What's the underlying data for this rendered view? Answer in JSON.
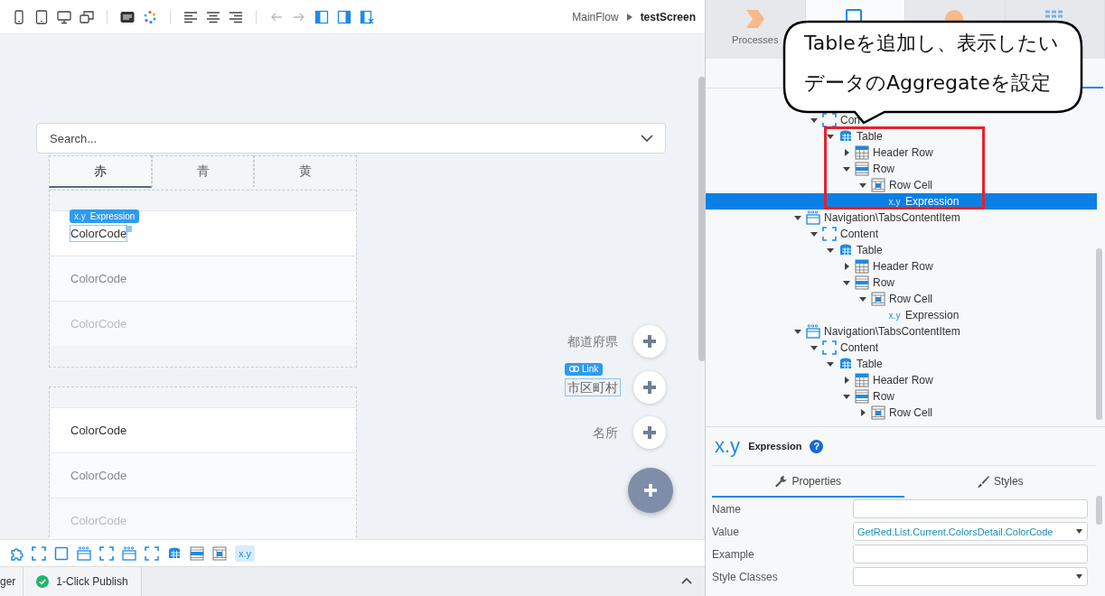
{
  "toolbar": {
    "breadcrumb": [
      {
        "label": "MainFlow",
        "current": false
      },
      {
        "label": "testScreen",
        "current": true
      }
    ]
  },
  "canvas": {
    "search": {
      "placeholder": "Search..."
    },
    "tabs": [
      {
        "label": "赤",
        "selected": true
      },
      {
        "label": "青",
        "selected": false
      },
      {
        "label": "黄",
        "selected": false
      }
    ],
    "tables": [
      {
        "rows": [
          {
            "text": "ColorCode",
            "selected": true,
            "badge": "Expression",
            "badge_glyph": "x.y"
          },
          {
            "text": "ColorCode",
            "selected": false
          },
          {
            "text": "ColorCode",
            "selected": false
          }
        ]
      },
      {
        "rows": [
          {
            "text": "ColorCode",
            "selected": false
          },
          {
            "text": "ColorCode",
            "selected": false
          },
          {
            "text": "ColorCode",
            "selected": false
          }
        ]
      }
    ],
    "actions": [
      {
        "label": "都道府県",
        "selected": false
      },
      {
        "label": "市区町村",
        "selected": true,
        "badge": "Link"
      },
      {
        "label": "名所",
        "selected": false
      }
    ]
  },
  "widget_bar": {
    "current": {
      "label": "x.y",
      "selected": true
    }
  },
  "bottom_tabs": [
    {
      "label": "ger",
      "kind": "plain"
    },
    {
      "label": "1-Click Publish",
      "kind": "status"
    }
  ],
  "side_tabs": [
    {
      "label": "Processes",
      "kind": "processes",
      "selected": false
    },
    {
      "kind": "interface",
      "selected": true
    },
    {
      "kind": "data",
      "selected": false
    },
    {
      "kind": "logic",
      "selected": false
    }
  ],
  "tree": {
    "continued": [
      {
        "label": "Con",
        "kind": "content",
        "expanded": true,
        "selected": false,
        "children": [
          {
            "label": "Table",
            "kind": "table",
            "expanded": true,
            "selected": false,
            "children": [
              {
                "label": "Header Row",
                "kind": "header-row",
                "expanded": false,
                "selected": false
              },
              {
                "label": "Row",
                "kind": "row",
                "expanded": true,
                "selected": false,
                "children": [
                  {
                    "label": "Row Cell",
                    "kind": "row-cell",
                    "expanded": true,
                    "selected": false,
                    "children": [
                      {
                        "label": "Expression",
                        "kind": "expression",
                        "glyph": "x.y",
                        "selected": true
                      }
                    ]
                  }
                ]
              }
            ]
          }
        ]
      }
    ],
    "items": [
      {
        "label": "Navigation\\TabsContentItem",
        "kind": "tabs-item",
        "expanded": true,
        "selected": false,
        "children": [
          {
            "label": "Content",
            "kind": "content",
            "expanded": true,
            "selected": false,
            "children": [
              {
                "label": "Table",
                "kind": "table",
                "expanded": true,
                "selected": false,
                "children": [
                  {
                    "label": "Header Row",
                    "kind": "header-row",
                    "expanded": false,
                    "selected": false
                  },
                  {
                    "label": "Row",
                    "kind": "row",
                    "expanded": true,
                    "selected": false,
                    "children": [
                      {
                        "label": "Row Cell",
                        "kind": "row-cell",
                        "expanded": true,
                        "selected": false,
                        "children": [
                          {
                            "label": "Expression",
                            "kind": "expression",
                            "glyph": "x.y",
                            "selected": false
                          }
                        ]
                      }
                    ]
                  }
                ]
              }
            ]
          }
        ]
      },
      {
        "label": "Navigation\\TabsContentItem",
        "kind": "tabs-item",
        "expanded": true,
        "selected": false,
        "children": [
          {
            "label": "Content",
            "kind": "content",
            "expanded": true,
            "selected": false,
            "children": [
              {
                "label": "Table",
                "kind": "table",
                "expanded": true,
                "selected": false,
                "children": [
                  {
                    "label": "Header Row",
                    "kind": "header-row",
                    "expanded": false,
                    "selected": false
                  },
                  {
                    "label": "Row",
                    "kind": "row",
                    "expanded": true,
                    "selected": false,
                    "children": [
                      {
                        "label": "Row Cell",
                        "kind": "row-cell",
                        "expanded": false,
                        "selected": false
                      }
                    ]
                  }
                ]
              }
            ]
          }
        ]
      }
    ]
  },
  "properties": {
    "glyph": "x.y",
    "title": "Expression",
    "help_glyph": "?",
    "tabs": [
      {
        "label": "Properties",
        "kind": "properties",
        "selected": true
      },
      {
        "label": "Styles",
        "kind": "styles",
        "selected": false
      }
    ],
    "fields": [
      {
        "label": "Name",
        "kind": "text"
      },
      {
        "label": "Value",
        "kind": "dropdown",
        "value": "GetRed.List.Current.ColorsDetail.ColorCode"
      },
      {
        "label": "Example",
        "kind": "text"
      },
      {
        "label": "Style Classes",
        "kind": "dropdown"
      }
    ]
  },
  "callout": {
    "lines": [
      "Tableを追加し、表示したい",
      "データのAggregateを設定"
    ]
  }
}
